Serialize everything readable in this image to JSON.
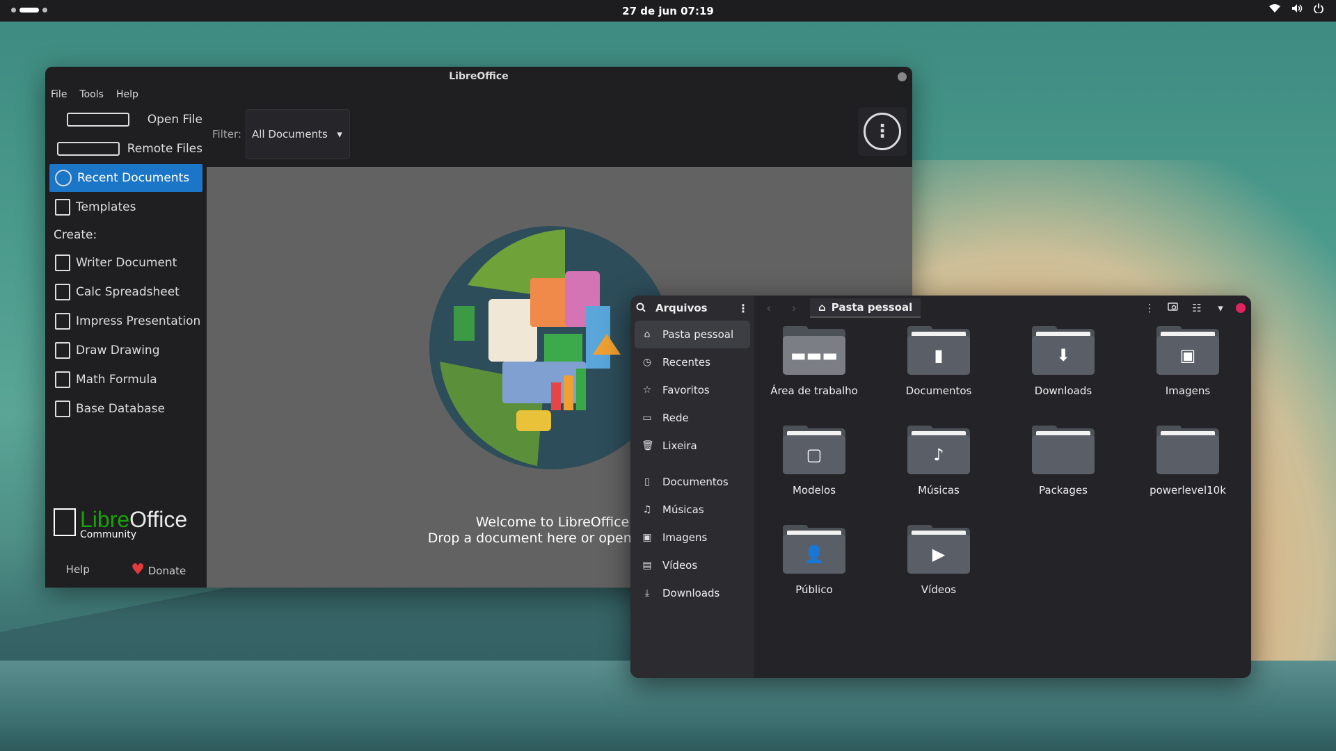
{
  "topbar": {
    "clock": "27 de jun  07:19",
    "wifi_icon": "▾",
    "volume_icon": "🔊",
    "power_icon": "⏻"
  },
  "libreoffice": {
    "title": "LibreOffice",
    "menu": [
      "File",
      "Tools",
      "Help"
    ],
    "sidebar": {
      "open_file": "Open File",
      "remote_files": "Remote Files",
      "recent_documents": "Recent Documents",
      "templates": "Templates",
      "create_label": "Create:",
      "create_items": [
        "Writer Document",
        "Calc Spreadsheet",
        "Impress Presentation",
        "Draw Drawing",
        "Math Formula",
        "Base Database"
      ]
    },
    "logo": {
      "libre": "Libre",
      "office": "Office",
      "edition": "Community"
    },
    "footer": {
      "help": "Help",
      "donate": "Donate"
    },
    "filter": {
      "label": "Filter:",
      "value": "All Documents"
    },
    "welcome": {
      "line1": "Welcome to LibreOffice.",
      "line2": "Drop a document here or open an app"
    }
  },
  "files": {
    "app_title": "Arquivos",
    "path": "Pasta pessoal",
    "sidebar": [
      "Pasta pessoal",
      "Recentes",
      "Favoritos",
      "Rede",
      "Lixeira"
    ],
    "bookmarks": [
      "Documentos",
      "Músicas",
      "Imagens",
      "Vídeos",
      "Downloads"
    ],
    "folders": [
      "Área de trabalho",
      "Documentos",
      "Downloads",
      "Imagens",
      "Modelos",
      "Músicas",
      "Packages",
      "powerlevel10k",
      "Público",
      "Vídeos"
    ],
    "colors": {
      "close_button": "#e0245e"
    }
  }
}
